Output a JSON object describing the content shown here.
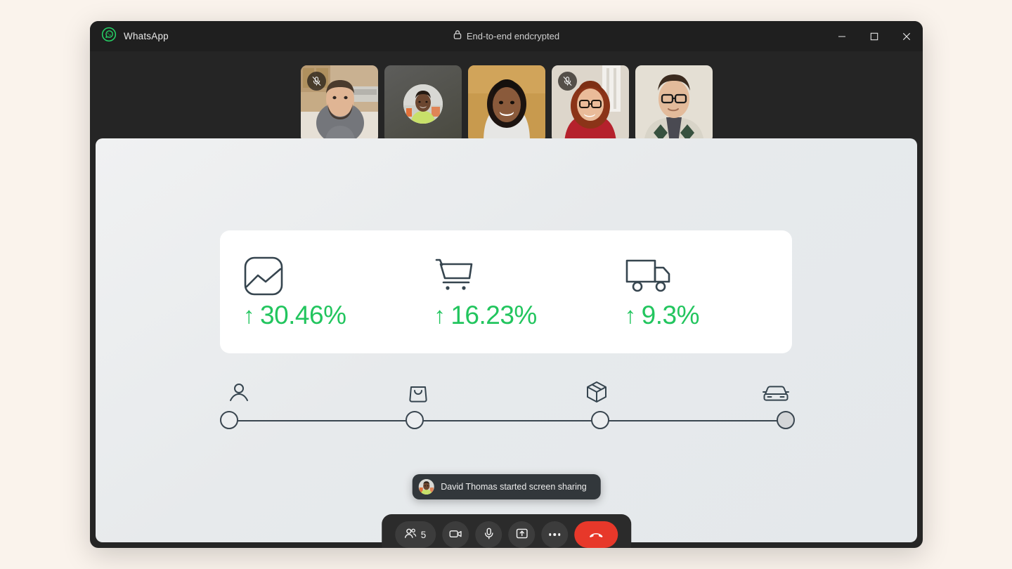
{
  "window": {
    "brand_label": "WhatsApp",
    "brand_icon": "whatsapp-logo-icon",
    "encryption_label": "End-to-end endcrypted",
    "encryption_icon": "lock-icon",
    "controls": {
      "minimize": "minimize-icon",
      "maximize": "maximize-icon",
      "close": "close-icon"
    },
    "accent_color": "#25D366",
    "titlebar_color": "#1f1f1f",
    "chrome_color": "#252525",
    "desktop_color": "#faf3ec"
  },
  "participants": [
    {
      "id": "p1",
      "muted": true,
      "type": "video",
      "mute_icon": "mic-off-icon"
    },
    {
      "id": "p2",
      "muted": false,
      "type": "avatar",
      "mute_icon": ""
    },
    {
      "id": "p3",
      "muted": false,
      "type": "video",
      "mute_icon": ""
    },
    {
      "id": "p4",
      "muted": true,
      "type": "video",
      "mute_icon": "mic-off-icon"
    },
    {
      "id": "p5",
      "muted": false,
      "type": "video",
      "mute_icon": ""
    }
  ],
  "shared_screen": {
    "metrics": [
      {
        "icon": "image-chart-icon",
        "arrow": "↑",
        "value": "30.46%"
      },
      {
        "icon": "shopping-cart-icon",
        "arrow": "↑",
        "value": "16.23%"
      },
      {
        "icon": "delivery-truck-icon",
        "arrow": "↑",
        "value": "9.3%"
      }
    ],
    "metric_color": "#22c55e",
    "icon_color": "#36454f",
    "timeline": [
      {
        "icon": "user-icon",
        "state": "open"
      },
      {
        "icon": "shopping-bag-icon",
        "state": "open"
      },
      {
        "icon": "package-box-icon",
        "state": "open"
      },
      {
        "icon": "car-icon",
        "state": "filled"
      }
    ]
  },
  "toast": {
    "avatar_icon": "user-avatar",
    "message": "David Thomas started screen sharing"
  },
  "controls": {
    "participants": {
      "icon": "people-icon",
      "count": "5"
    },
    "camera": {
      "icon": "video-camera-icon"
    },
    "microphone": {
      "icon": "microphone-icon"
    },
    "share_screen": {
      "icon": "share-screen-icon"
    },
    "more": {
      "icon": "more-horizontal-icon"
    },
    "end_call": {
      "icon": "end-call-icon",
      "color": "#e7382a"
    }
  }
}
